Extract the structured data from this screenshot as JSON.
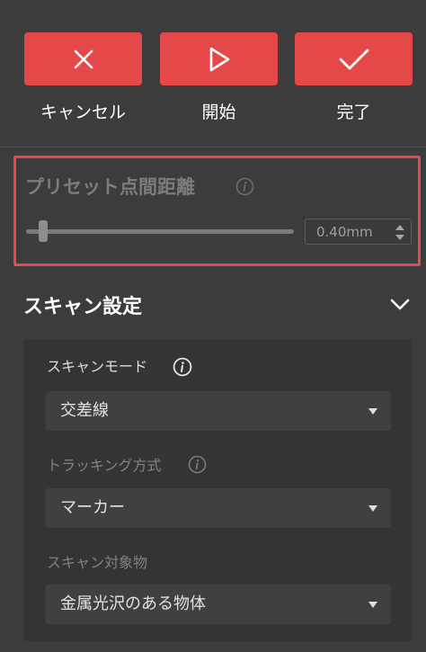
{
  "actions": {
    "cancel_label": "キャンセル",
    "start_label": "開始",
    "done_label": "完了"
  },
  "preset": {
    "title": "プリセット点間距離",
    "value": "0.40mm",
    "slider_fraction": 0.05
  },
  "scan_settings": {
    "title": "スキャン設定",
    "fields": [
      {
        "label": "スキャンモード",
        "value": "交差線",
        "has_info": true
      },
      {
        "label": "トラッキング方式",
        "value": "マーカー",
        "has_info": true
      },
      {
        "label": "スキャン対象物",
        "value": "金属光沢のある物体",
        "has_info": false
      }
    ]
  },
  "colors": {
    "accent": "#e54848",
    "highlight_border": "#e5484d",
    "background": "#3c3c3c"
  },
  "icons": {
    "cancel": "close-icon",
    "start": "play-icon",
    "done": "check-icon",
    "info": "info-icon",
    "collapse": "chevron-down-icon",
    "dropdown": "caret-down-icon",
    "spin": "spin-arrows-icon"
  }
}
